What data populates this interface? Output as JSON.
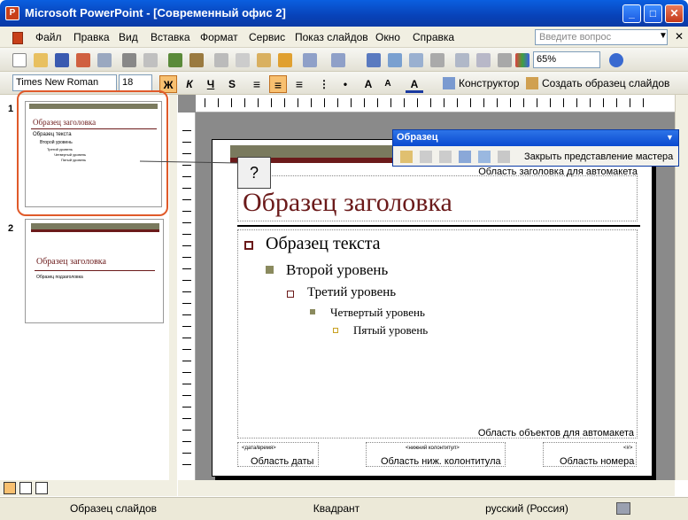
{
  "window": {
    "title": "Microsoft PowerPoint - [Современный офис 2]",
    "icon": "powerpoint-app-icon"
  },
  "menu": {
    "items": [
      "Файл",
      "Правка",
      "Вид",
      "Вставка",
      "Формат",
      "Сервис",
      "Показ слайдов",
      "Окно",
      "Справка"
    ],
    "help_placeholder": "Введите вопрос"
  },
  "toolbar": {
    "zoom": "65%"
  },
  "format_toolbar": {
    "font": "Times New Roman",
    "size": "18",
    "bold": "Ж",
    "italic": "К",
    "underline": "Ч",
    "shadow": "S",
    "designer_label": "Конструктор",
    "create_master_label": "Создать образец слайдов"
  },
  "thumbnails": [
    {
      "number": "1",
      "title": "Образец заголовка",
      "lines": [
        "Образец текста",
        "Второй уровень",
        "Третий уровень",
        "Четвертый уровень",
        "Пятый уровень"
      ]
    },
    {
      "number": "2",
      "title": "Образец заголовка",
      "subtitle": "Образец подзаголовка"
    }
  ],
  "callout": {
    "text": "?"
  },
  "floating_toolbar": {
    "title": "Образец",
    "close_label": "Закрыть представление мастера"
  },
  "slide": {
    "title_area_label": "Область заголовка для автомакета",
    "title": "Образец заголовка",
    "levels": [
      "Образец текста",
      "Второй уровень",
      "Третий уровень",
      "Четвертый уровень",
      "Пятый уровень"
    ],
    "object_area_label": "Область объектов для автомакета",
    "date_small": "<дата/время>",
    "date_label": "Область даты",
    "footer_small": "<нижний колонтитул>",
    "footer_label": "Область ниж. колонтитула",
    "number_small": "<#>",
    "number_label": "Область номера"
  },
  "status": {
    "mode": "Образец слайдов",
    "design": "Квадрант",
    "language": "русский (Россия)"
  },
  "colors": {
    "accent": "#6b1a1a",
    "bar_olive": "#7a7a5e",
    "highlight": "#e05a2a"
  }
}
